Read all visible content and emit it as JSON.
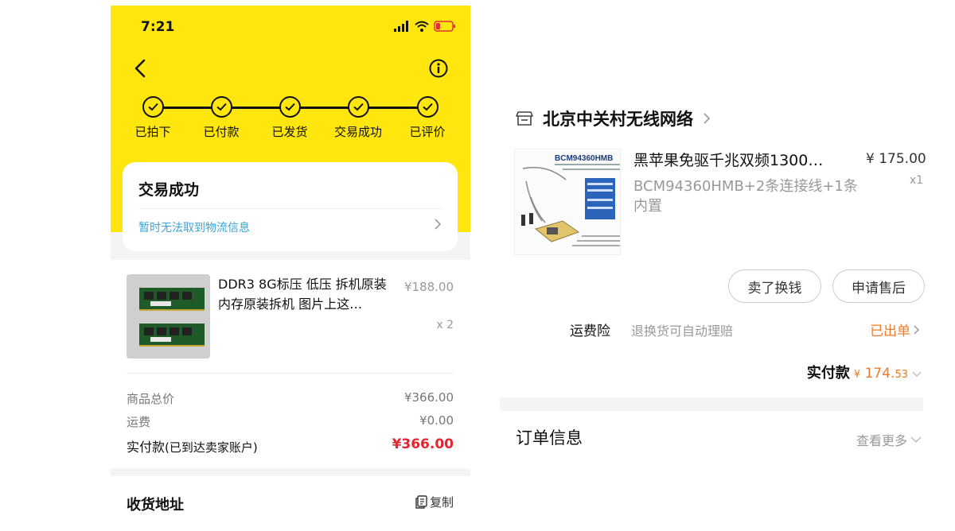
{
  "left": {
    "status_bar": {
      "time": "7:21"
    },
    "steps": [
      {
        "label": "已拍下"
      },
      {
        "label": "已付款"
      },
      {
        "label": "已发货"
      },
      {
        "label": "交易成功"
      },
      {
        "label": "已评价"
      }
    ],
    "status_card": {
      "title": "交易成功",
      "logistics": "暂时无法取到物流信息"
    },
    "goods": {
      "name": "DDR3 8G标压 低压 拆机原装内存原装拆机 图片上这…",
      "price": "¥188.00",
      "qty": "x 2",
      "subtotal_label": "商品总价",
      "subtotal_value": "¥366.00",
      "shipping_label": "运费",
      "shipping_value": "¥0.00",
      "total_label": "实付款",
      "total_hint": "(已到达卖家账户)",
      "total_value": "¥366.00"
    },
    "address": {
      "title": "收货地址",
      "copy": "复制"
    }
  },
  "right": {
    "shop": {
      "name": "北京中关村无线网络"
    },
    "product": {
      "image_text": "BCM94360HMB",
      "title": "黑苹果免驱千兆双频1300…",
      "spec": "BCM94360HMB+2条连接线+1条内置",
      "price": "¥ 175.00",
      "qty": "x1"
    },
    "buttons": {
      "sell": "卖了换钱",
      "after_sale": "申请售后"
    },
    "insurance": {
      "label": "运费险",
      "desc": "退换货可自动理赔",
      "status": "已出单"
    },
    "paid": {
      "label": "实付款",
      "symbol": "¥",
      "integer": "174.",
      "decimal": "53"
    },
    "order": {
      "title": "订单信息",
      "more": "查看更多"
    }
  },
  "colors": {
    "header_yellow": "#ffe60f",
    "price_red": "#e8232e",
    "accent_orange": "#f07a28",
    "link_blue": "#3aa5d8"
  },
  "icons": [
    "back-arrow-icon",
    "info-icon",
    "check-icon",
    "chevron-right-icon",
    "copy-icon",
    "shop-icon",
    "chevron-down-icon",
    "signal-icon",
    "wifi-icon",
    "battery-icon"
  ]
}
